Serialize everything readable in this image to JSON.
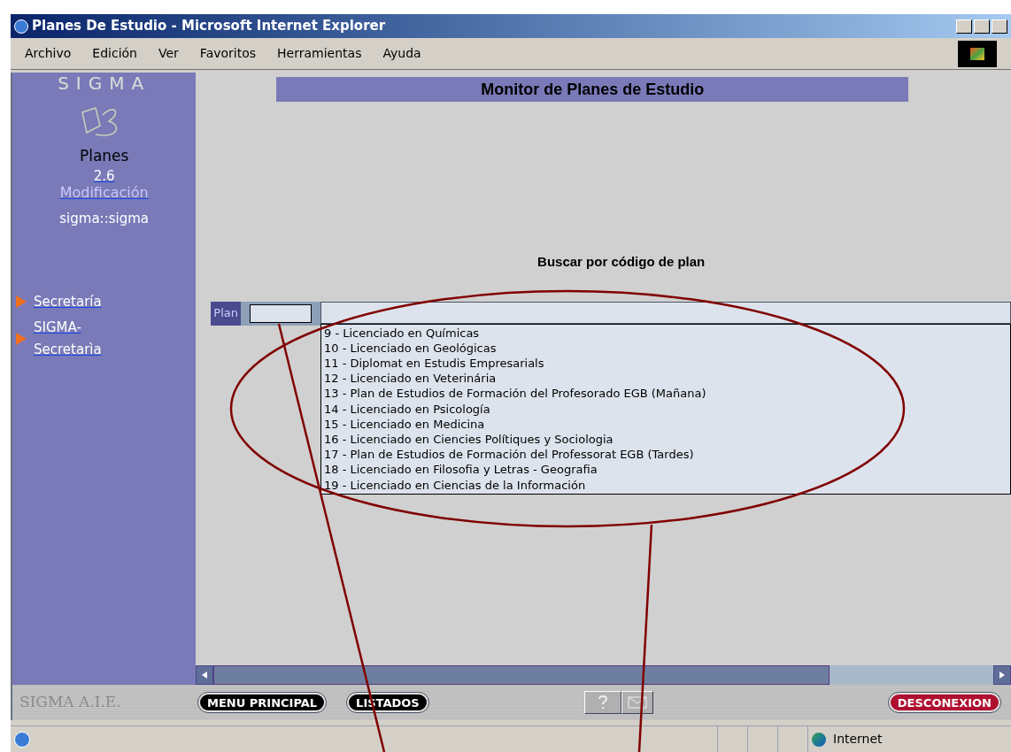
{
  "window": {
    "title": "Planes De Estudio - Microsoft Internet Explorer"
  },
  "menu": [
    "Archivo",
    "Edición",
    "Ver",
    "Favoritos",
    "Herramientas",
    "Ayuda"
  ],
  "sidebar": {
    "logo": "SIGMA",
    "app": "Planes",
    "version": "2.6",
    "mode": "Modificación",
    "user": "sigma::sigma",
    "links": [
      {
        "label": "Secretaría"
      },
      {
        "label": "SIGMA-\nSecretarìa"
      }
    ]
  },
  "header": "Monitor de Planes de Estudio",
  "search": {
    "title": "Buscar por código de plan",
    "label": "Plan",
    "options": [
      "9 - Licenciado en Químicas",
      "10 - Licenciado en Geológicas",
      "11 - Diplomat en Estudis Empresarials",
      "12 - Licenciado en Veterinária",
      "13 - Plan de Estudios de Formación del Profesorado EGB (Mañana)",
      "14 - Licenciado en Psicología",
      "15 - Licenciado en Medicina",
      "16 - Licenciado en Ciencies Polítiques y Sociologia",
      "17 - Plan de Estudios de Formación del Professorat EGB (Tardes)",
      "18 - Licenciado en Filosofia y Letras - Geografia",
      "19 - Licenciado en Ciencias de la Información"
    ]
  },
  "footer": {
    "brand": "SIGMA A.I.E.",
    "buttons": [
      {
        "label": "MENU PRINCIPAL",
        "kind": "dark"
      },
      {
        "label": "LISTADOS",
        "kind": "dark"
      },
      {
        "label": "DESCONEXION",
        "kind": "danger"
      }
    ]
  },
  "status_bar": {
    "zone": "Internet"
  }
}
